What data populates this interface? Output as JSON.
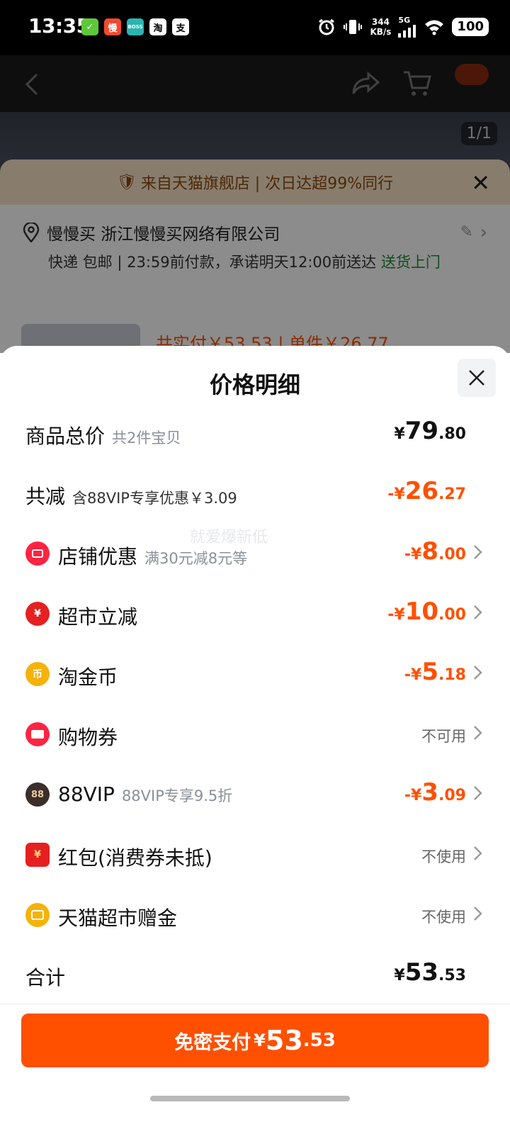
{
  "status_bar": {
    "time": "13:35",
    "apps": [
      {
        "icon": "wechat-icon",
        "glyph": "✓",
        "color": "#5fc73a"
      },
      {
        "icon": "manmanmai-icon",
        "glyph": "慢",
        "color": "#f04a2f"
      },
      {
        "icon": "boss-icon",
        "glyph": "BOSS",
        "color": "#2ab5b0"
      },
      {
        "icon": "taobao-icon",
        "glyph": "淘",
        "color": "#ffffff"
      },
      {
        "icon": "alipay-icon",
        "glyph": "支",
        "color": "#ffffff"
      }
    ],
    "speed_value": "344",
    "speed_unit": "KB/s",
    "network": "5G",
    "battery": "100"
  },
  "underlying": {
    "image_counter": "1/1",
    "banner_text": "来自天猫旗舰店 | 次日达超99%同行",
    "address_name": "慢慢买 浙江慢慢买网络有限公司",
    "delivery_text": "快递 包邮 | 23:59前付款，承诺明天12:00前送达",
    "delivery_green": "送货上门",
    "price_preview": "共实付￥53.53 | 单件￥26.77"
  },
  "sheet": {
    "title": "价格明细",
    "watermark": "就爱爆新低",
    "rows": [
      {
        "label": "商品总价",
        "sub": "共2件宝贝",
        "sign": "",
        "int": "79",
        "dec": ".80",
        "color": "black"
      },
      {
        "label": "共减",
        "sub": "含88VIP专享优惠￥3.09",
        "sign": "-",
        "int": "26",
        "dec": ".27",
        "color": "orange"
      },
      {
        "label": "店铺优惠",
        "sub": "满30元减8元等",
        "sign": "-",
        "int": "8",
        "dec": ".00",
        "color": "orange",
        "icon": "store-coupon-icon",
        "icon_color": "#ff2442"
      },
      {
        "label": "超市立减",
        "sub": "",
        "sign": "-",
        "int": "10",
        "dec": ".00",
        "color": "orange",
        "icon": "supermarket-discount-icon",
        "icon_color": "#e62020"
      },
      {
        "label": "淘金币",
        "sub": "",
        "sign": "-",
        "int": "5",
        "dec": ".18",
        "color": "orange",
        "icon": "gold-coin-icon",
        "icon_color": "#f5b20a"
      },
      {
        "label": "购物券",
        "sub": "",
        "status": "不可用",
        "icon": "shopping-voucher-icon",
        "icon_color": "#ff2442"
      },
      {
        "label": "88VIP",
        "sub": "88VIP专享9.5折",
        "sign": "-",
        "int": "3",
        "dec": ".09",
        "color": "orange",
        "icon": "vip88-icon",
        "icon_color": "#3a2f2a"
      },
      {
        "label": "红包(消费券未抵)",
        "sub": "",
        "status": "不使用",
        "icon": "red-packet-icon",
        "icon_color": "#e62020"
      },
      {
        "label": "天猫超市赠金",
        "sub": "",
        "status": "不使用",
        "icon": "tmall-gift-icon",
        "icon_color": "#f5b20a"
      }
    ],
    "total_label": "合计",
    "total_int": "53",
    "total_dec": ".53",
    "currency": "¥",
    "pay_button": {
      "label": "免密支付",
      "int": "53",
      "dec": ".53"
    }
  }
}
